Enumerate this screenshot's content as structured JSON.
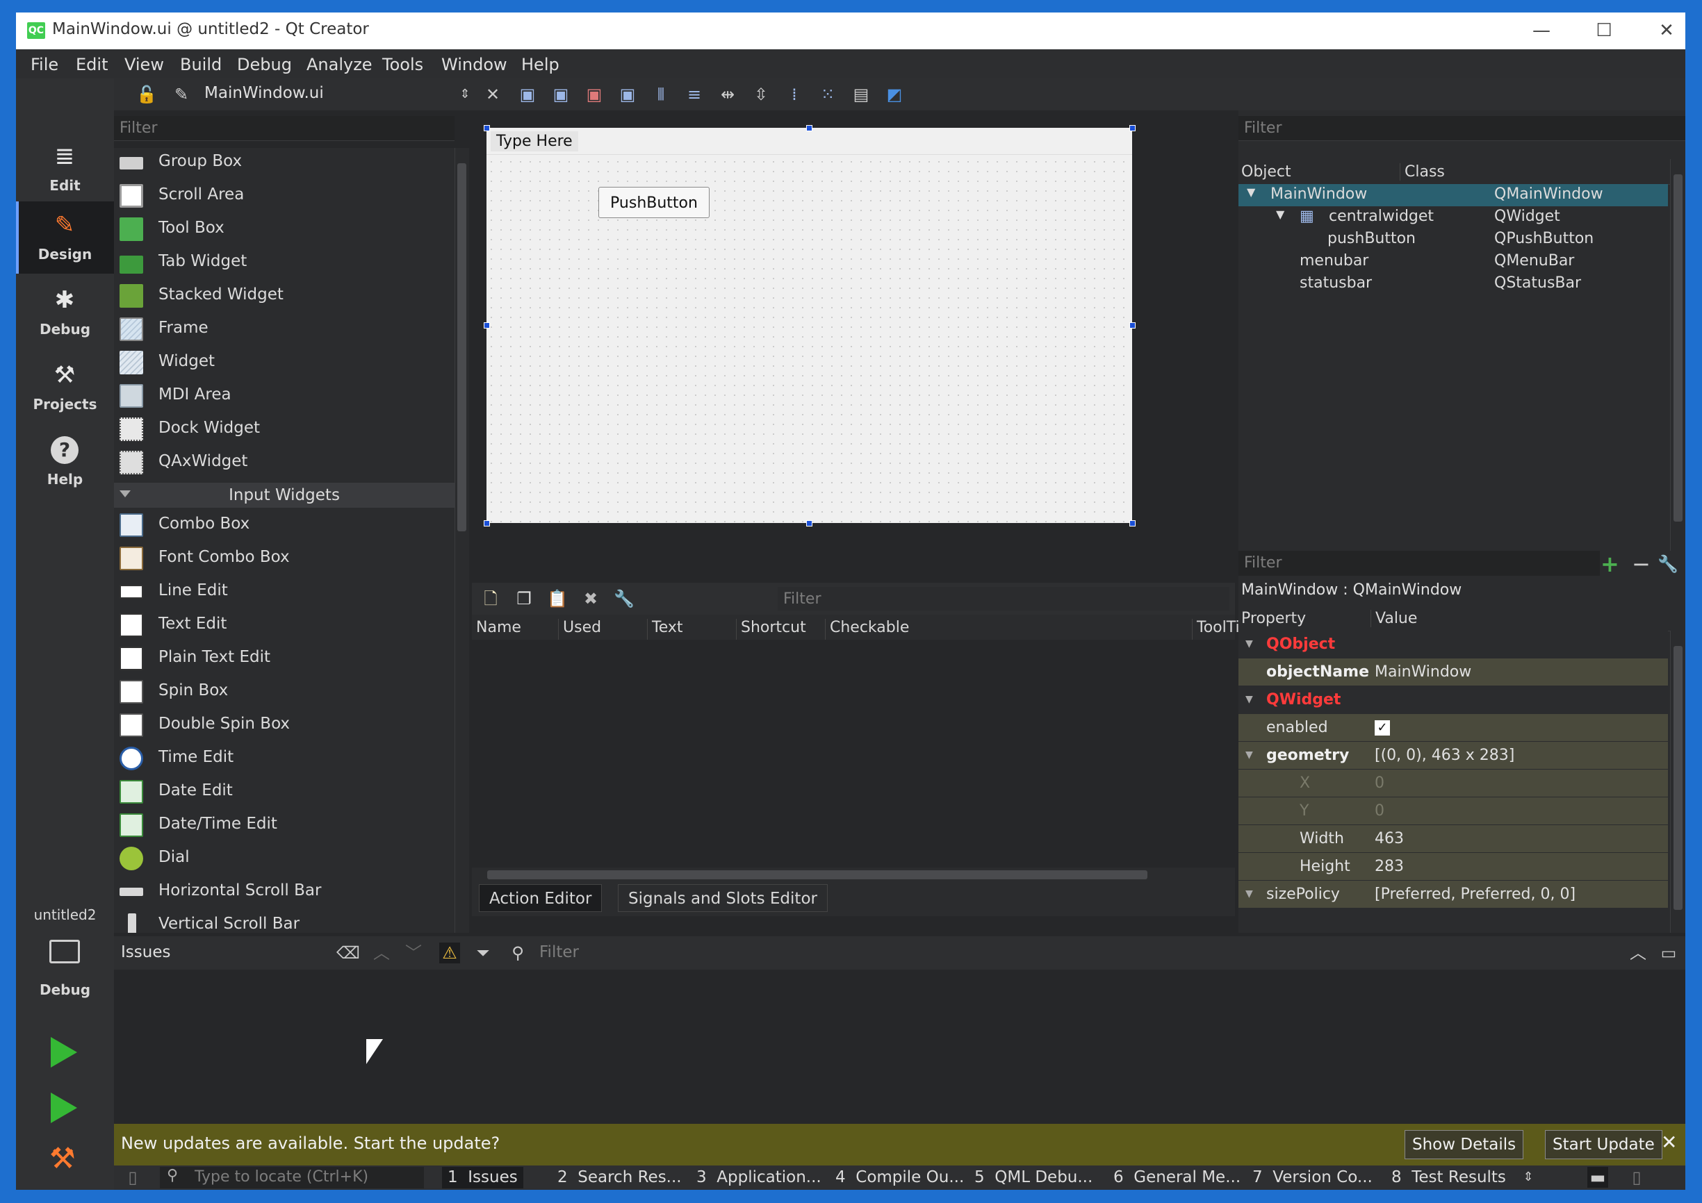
{
  "window": {
    "title": "MainWindow.ui @ untitled2 - Qt Creator",
    "app_badge": "QC",
    "controls": {
      "minimize": "—",
      "maximize": "☐",
      "close": "✕"
    }
  },
  "menu": [
    "File",
    "Edit",
    "View",
    "Build",
    "Debug",
    "Analyze",
    "Tools",
    "Window",
    "Help"
  ],
  "modes": [
    {
      "label": "Edit",
      "icon": "≣"
    },
    {
      "label": "Design",
      "icon": "✎",
      "active": true
    },
    {
      "label": "Debug",
      "icon": "✱"
    },
    {
      "label": "Projects",
      "icon": "⚒"
    },
    {
      "label": "Help",
      "icon": "?"
    }
  ],
  "project": {
    "name": "untitled2",
    "kit": "Debug"
  },
  "editor_toolbar": {
    "file": "MainWindow.ui"
  },
  "widget_box": {
    "filter_placeholder": "Filter",
    "items_top": [
      "Group Box",
      "Scroll Area",
      "Tool Box",
      "Tab Widget",
      "Stacked Widget",
      "Frame",
      "Widget",
      "MDI Area",
      "Dock Widget",
      "QAxWidget"
    ],
    "category": "Input Widgets",
    "items_input": [
      "Combo Box",
      "Font Combo Box",
      "Line Edit",
      "Text Edit",
      "Plain Text Edit",
      "Spin Box",
      "Double Spin Box",
      "Time Edit",
      "Date Edit",
      "Date/Time Edit",
      "Dial",
      "Horizontal Scroll Bar",
      "Vertical Scroll Bar"
    ]
  },
  "form": {
    "menu_placeholder": "Type Here",
    "button": "PushButton"
  },
  "action_editor": {
    "filter_placeholder": "Filter",
    "columns": [
      "Name",
      "Used",
      "Text",
      "Shortcut",
      "Checkable",
      "ToolTip"
    ],
    "tabs": [
      "Action Editor",
      "Signals and Slots Editor"
    ]
  },
  "object_inspector": {
    "filter_placeholder": "Filter",
    "columns": [
      "Object",
      "Class"
    ],
    "rows": [
      {
        "object": "MainWindow",
        "class": "QMainWindow"
      },
      {
        "object": "centralwidget",
        "class": "QWidget"
      },
      {
        "object": "pushButton",
        "class": "QPushButton"
      },
      {
        "object": "menubar",
        "class": "QMenuBar"
      },
      {
        "object": "statusbar",
        "class": "QStatusBar"
      }
    ]
  },
  "property_editor": {
    "filter_placeholder": "Filter",
    "context": "MainWindow : QMainWindow",
    "columns": [
      "Property",
      "Value"
    ],
    "rows": [
      {
        "name": "QObject",
        "value": "",
        "kind": "cat"
      },
      {
        "name": "objectName",
        "value": "MainWindow",
        "kind": "bold"
      },
      {
        "name": "QWidget",
        "value": "",
        "kind": "cat"
      },
      {
        "name": "enabled",
        "value": "✓",
        "kind": "normal"
      },
      {
        "name": "geometry",
        "value": "[(0, 0), 463 x 283]",
        "kind": "bold"
      },
      {
        "name": "X",
        "value": "0",
        "kind": "dim"
      },
      {
        "name": "Y",
        "value": "0",
        "kind": "dim"
      },
      {
        "name": "Width",
        "value": "463",
        "kind": "sub"
      },
      {
        "name": "Height",
        "value": "283",
        "kind": "sub"
      },
      {
        "name": "sizePolicy",
        "value": "[Preferred, Preferred, 0, 0]",
        "kind": "normal"
      }
    ]
  },
  "issues": {
    "title": "Issues",
    "filter_placeholder": "Filter"
  },
  "update": {
    "message": "New updates are available. Start the update?",
    "details": "Show Details",
    "start": "Start Update"
  },
  "locator": {
    "placeholder": "Type to locate (Ctrl+K)"
  },
  "output_tabs": [
    {
      "num": "1",
      "label": "Issues"
    },
    {
      "num": "2",
      "label": "Search Res..."
    },
    {
      "num": "3",
      "label": "Application..."
    },
    {
      "num": "4",
      "label": "Compile Ou..."
    },
    {
      "num": "5",
      "label": "QML Debu..."
    },
    {
      "num": "6",
      "label": "General Me..."
    },
    {
      "num": "7",
      "label": "Version Co..."
    },
    {
      "num": "8",
      "label": "Test Results"
    }
  ]
}
